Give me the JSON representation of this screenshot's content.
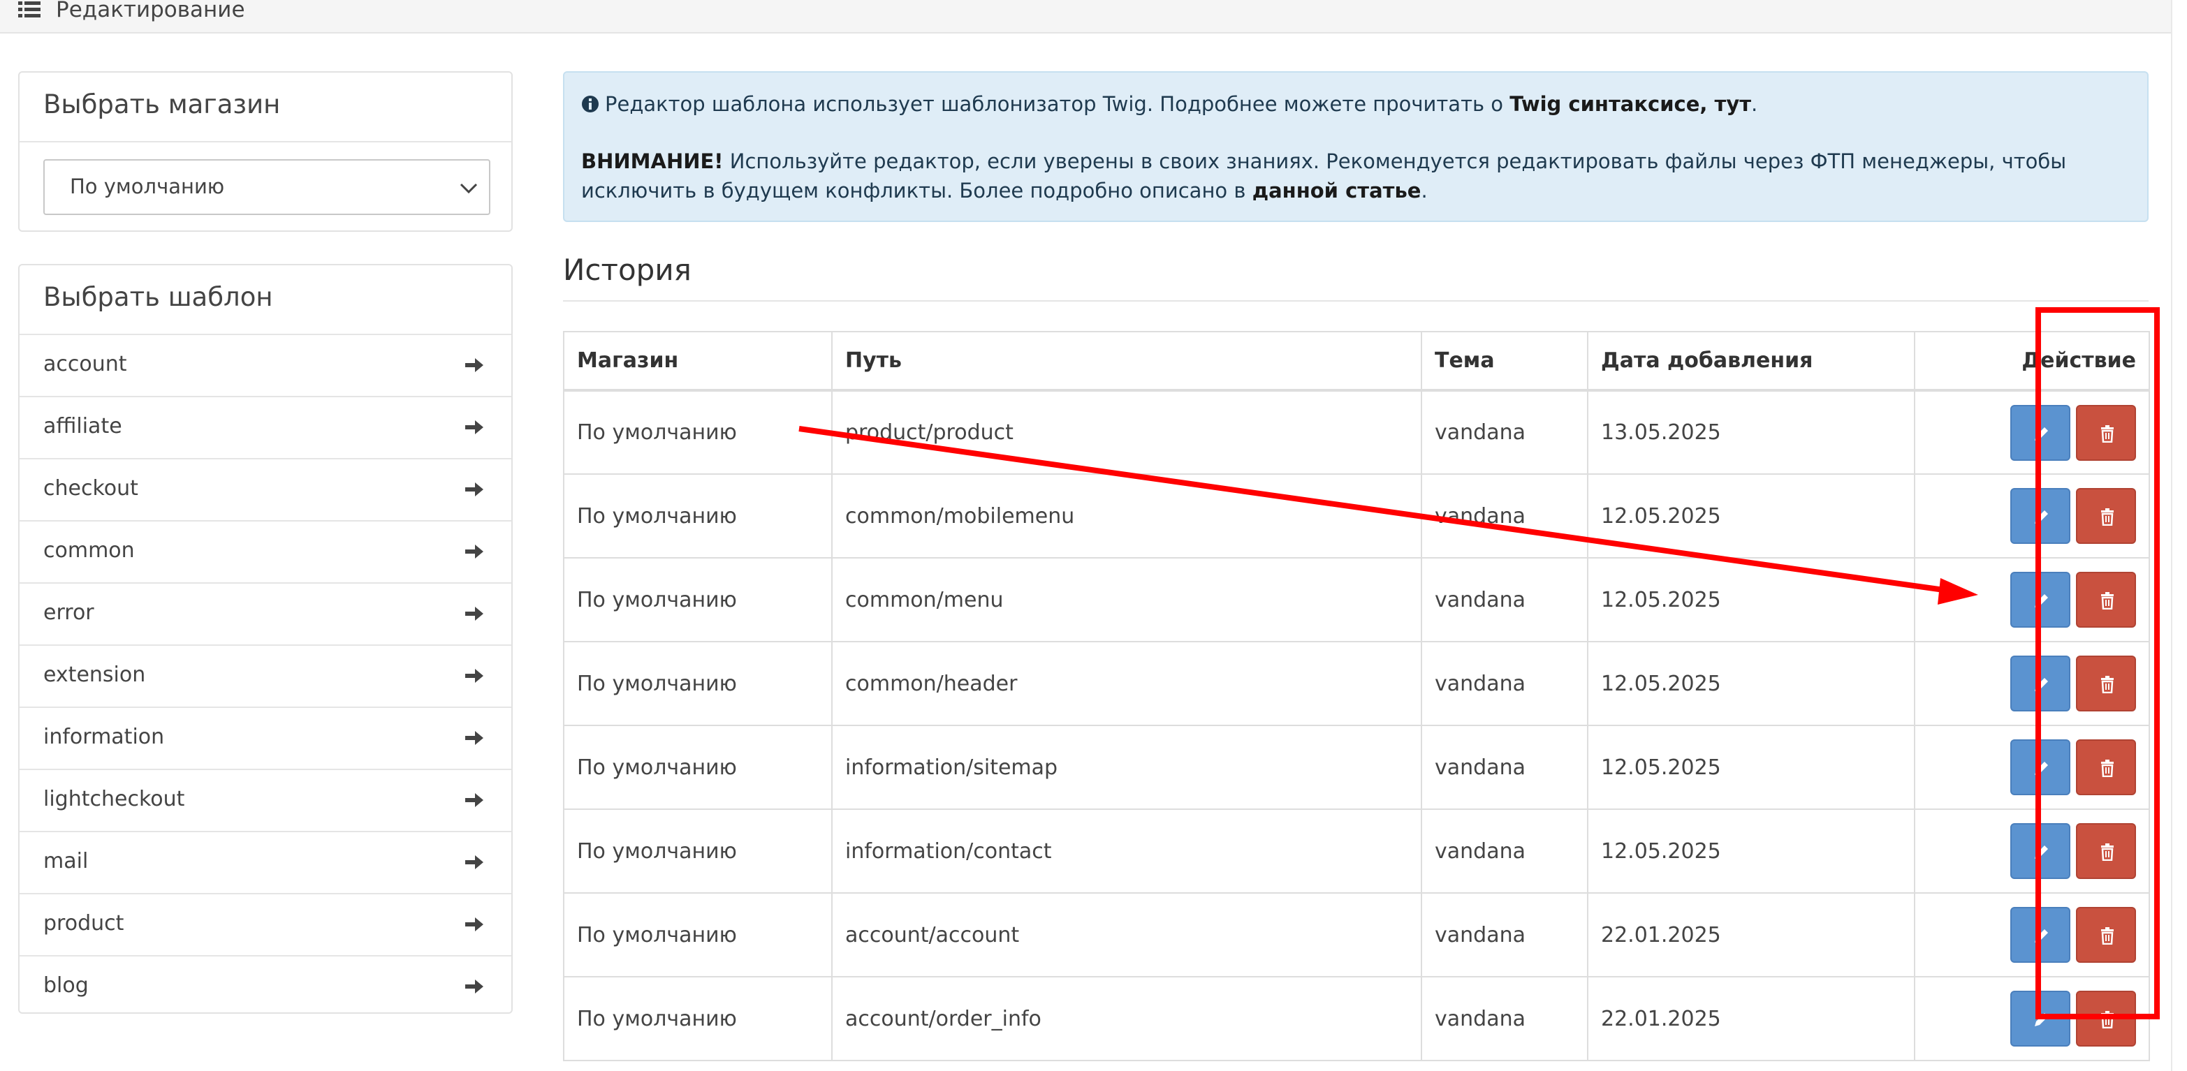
{
  "header": {
    "title": "Редактирование",
    "icon": "list-icon"
  },
  "store_panel": {
    "title": "Выбрать магазин",
    "selected_store": "По умолчанию"
  },
  "template_panel": {
    "title": "Выбрать шаблон",
    "items": [
      {
        "label": "account"
      },
      {
        "label": "affiliate"
      },
      {
        "label": "checkout"
      },
      {
        "label": "common"
      },
      {
        "label": "error"
      },
      {
        "label": "extension"
      },
      {
        "label": "information"
      },
      {
        "label": "lightcheckout"
      },
      {
        "label": "mail"
      },
      {
        "label": "product"
      },
      {
        "label": "blog"
      }
    ]
  },
  "alert": {
    "line1_text": "Редактор шаблона использует шаблонизатор Twig. Подробнее можете прочитать о ",
    "line1_link": "Twig синтаксисе, тут",
    "line1_end": ".",
    "warning_label": "ВНИМАНИЕ!",
    "warning_text": " Используйте редактор, если уверены в своих знаниях. Рекомендуется редактировать файлы через ФТП менеджеры, чтобы исключить в будущем конфликты. Более подробно описано в ",
    "warning_link": "данной статье",
    "warning_end": "."
  },
  "history": {
    "title": "История",
    "columns": {
      "store": "Магазин",
      "path": "Путь",
      "theme": "Тема",
      "date": "Дата добавления",
      "action": "Действие"
    },
    "rows": [
      {
        "store": "По умолчанию",
        "path": "product/product",
        "theme": "vandana",
        "date": "13.05.2025"
      },
      {
        "store": "По умолчанию",
        "path": "common/mobilemenu",
        "theme": "vandana",
        "date": "12.05.2025"
      },
      {
        "store": "По умолчанию",
        "path": "common/menu",
        "theme": "vandana",
        "date": "12.05.2025"
      },
      {
        "store": "По умолчанию",
        "path": "common/header",
        "theme": "vandana",
        "date": "12.05.2025"
      },
      {
        "store": "По умолчанию",
        "path": "information/sitemap",
        "theme": "vandana",
        "date": "12.05.2025"
      },
      {
        "store": "По умолчанию",
        "path": "information/contact",
        "theme": "vandana",
        "date": "12.05.2025"
      },
      {
        "store": "По умолчанию",
        "path": "account/account",
        "theme": "vandana",
        "date": "22.01.2025"
      },
      {
        "store": "По умолчанию",
        "path": "account/order_info",
        "theme": "vandana",
        "date": "22.01.2025"
      }
    ]
  },
  "colors": {
    "edit_button": "#5b93d0",
    "delete_button": "#c9513f",
    "annotation": "#ff0000",
    "alert_bg": "#dfedf7"
  },
  "icons": {
    "edit": "pencil-icon",
    "delete": "trash-icon",
    "arrow": "arrow-right-icon",
    "info": "info-circle-icon"
  }
}
